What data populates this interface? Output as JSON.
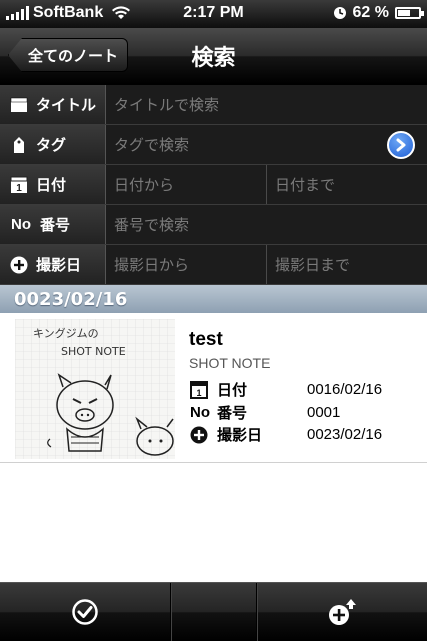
{
  "status_bar": {
    "carrier": "SoftBank",
    "time": "2:17 PM",
    "battery": "62 %",
    "battery_level": 0.62
  },
  "nav": {
    "back_label": "全てのノート",
    "title": "検索"
  },
  "form": {
    "title": {
      "label": "タイトル",
      "placeholder": "タイトルで検索"
    },
    "tag": {
      "label": "タグ",
      "placeholder": "タグで検索"
    },
    "date": {
      "label": "日付",
      "from_placeholder": "日付から",
      "to_placeholder": "日付まで"
    },
    "number": {
      "label": "番号",
      "icon_text": "No",
      "placeholder": "番号で検索"
    },
    "shoot_date": {
      "label": "撮影日",
      "from_placeholder": "撮影日から",
      "to_placeholder": "撮影日まで"
    }
  },
  "section": {
    "header": "0023/02/16"
  },
  "entry": {
    "title": "test",
    "subtitle": "SHOT NOTE",
    "date_label": "日付",
    "date_value": "0016/02/16",
    "number_icon_text": "No",
    "number_label": "番号",
    "number_value": "0001",
    "shoot_label": "撮影日",
    "shoot_value": "0023/02/16",
    "thumbnail_text": "キングジムの SHOT NOTE"
  },
  "colors": {
    "section_header": "#9fb0c0",
    "disclosure": "#1e5fd6"
  }
}
